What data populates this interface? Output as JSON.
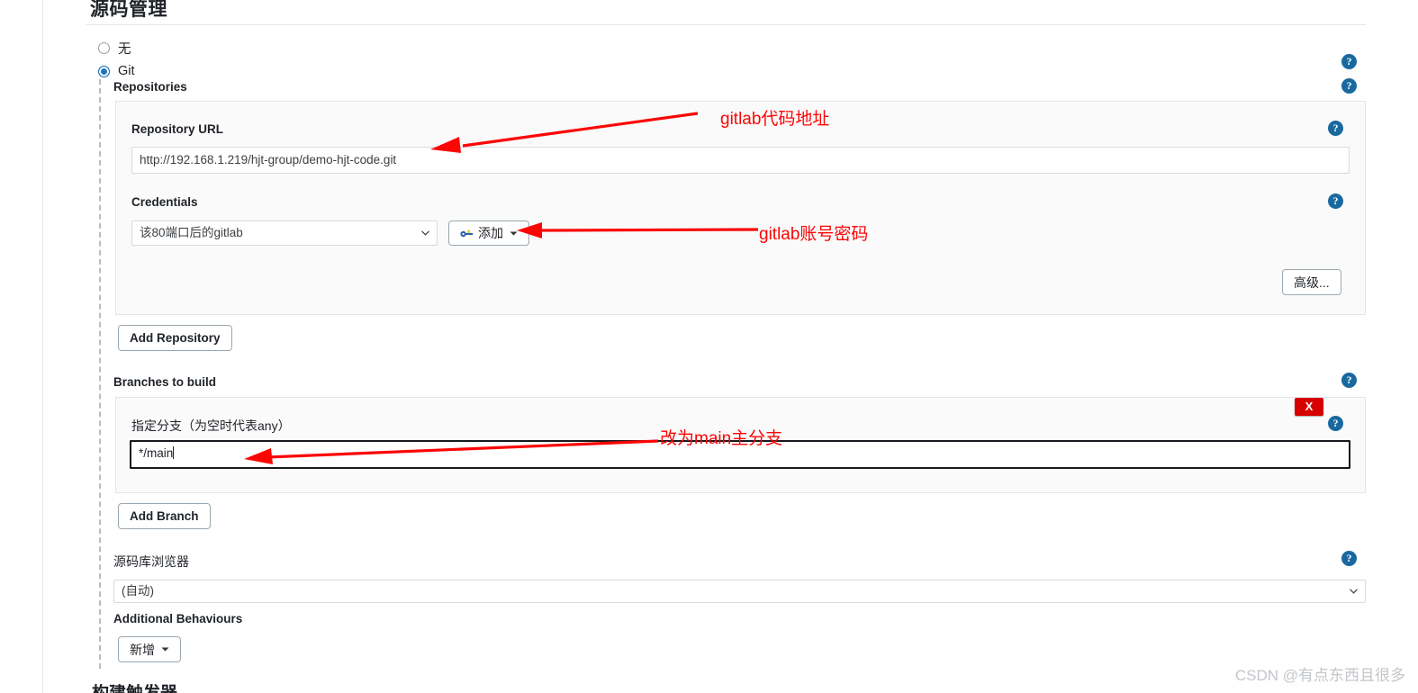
{
  "page": {
    "section_title": "源码管理",
    "cut_off_heading": "构建触发器",
    "watermark": "CSDN @有点东西且很多"
  },
  "scm_options": [
    {
      "label": "无",
      "selected": false
    },
    {
      "label": "Git",
      "selected": true
    }
  ],
  "git": {
    "repositories_label": "Repositories",
    "repository": {
      "url_label": "Repository URL",
      "url_value": "http://192.168.1.219/hjt-group/demo-hjt-code.git",
      "credentials_label": "Credentials",
      "credentials_value": "该80端口后的gitlab",
      "add_credentials_button": "添加",
      "advanced_button": "高级..."
    },
    "add_repository_button": "Add Repository",
    "branches_label": "Branches to build",
    "branch": {
      "name_label": "指定分支（为空时代表any）",
      "name_value": "*/main",
      "delete_button": "X"
    },
    "add_branch_button": "Add Branch",
    "browser_label": "源码库浏览器",
    "browser_value": "(自动)",
    "additional_behaviours_label": "Additional Behaviours",
    "add_behaviour_button": "新增"
  },
  "help_icon": "?",
  "annotations": [
    {
      "text": "gitlab代码地址"
    },
    {
      "text": "gitlab账号密码"
    },
    {
      "text": "改为main主分支"
    }
  ],
  "colors": {
    "annotation_red": "#fc0505",
    "help_blue": "#19699e",
    "delete_red": "#d60000",
    "radio_blue": "#1b76bd"
  }
}
